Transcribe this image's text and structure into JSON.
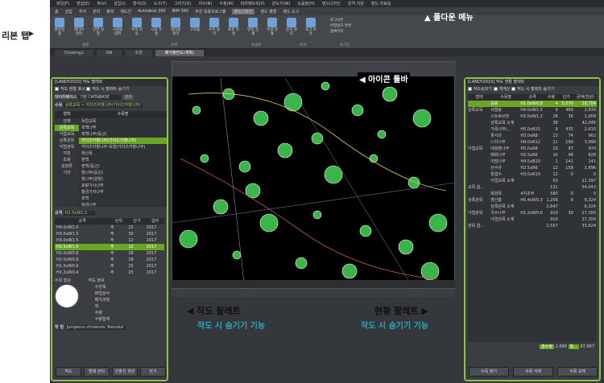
{
  "menu": [
    "파일(F)",
    "편집(E)",
    "뷰(V)",
    "삽입(I)",
    "형식(O)",
    "도구(T)",
    "그리기(D)",
    "치수(N)",
    "수정(M)",
    "파라메트릭(P)",
    "윈도우(W)",
    "도움말(H)",
    "랜드디자인",
    "원격 지원",
    "랜드 자료실"
  ],
  "ribbon_tabs": [
    "홈",
    "삽입",
    "주석",
    "관리",
    "출력",
    "애드인",
    "Autodesk 360",
    "BIM 360",
    "추천 응용프로그램",
    "랜드디자인",
    "랜드 평형",
    "랜드 도구"
  ],
  "ribbon_buttons": [
    "환경설정",
    "레이어 관리",
    "단면 설정",
    "시설물 입력",
    "수목 이동",
    "시점 작성",
    "테이블 정리",
    "구조물",
    "수목 정리",
    "표준 작성",
    "면적 집계",
    "수량 산출",
    "문서 관리",
    "로그 아웃"
  ],
  "ribbon_groups": [
    "설정",
    "수목",
    "수량표",
    "문서",
    "로그인"
  ],
  "login_items": [
    "로그아웃",
    "비밀번호 변경",
    "홈페이지"
  ],
  "doc_tabs": [
    "Drawing1",
    "NN",
    "조경",
    "배식평면도(계획)"
  ],
  "annotations": {
    "ribbon_tab": "리본 탭",
    "pulldown": "풀다운 메뉴",
    "icon_toolbar": "아이콘 툴바",
    "work_palette": "작도 팔레트",
    "status_palette": "현황 팔레트",
    "hide_caption": "작도 시 숨기기 기능"
  },
  "left": {
    "title": "[LANDY2015] 작도 팔레트",
    "opt1": "작도 현황 표시",
    "opt2": "작도 시 팔레트 숨기기",
    "db_label": "데이터베이스",
    "db_value": "기본 DATABASE",
    "db_btn": "관리",
    "tree_label": "수목",
    "tree_value": "상록교목 > 카이즈카향나무(가이즈카향나무)",
    "col1": "형태",
    "col2": "수목명",
    "cats": [
      "전체",
      "상록교목",
      "낙엽교목",
      "상록관목",
      "낙엽관목",
      "지피",
      "초화",
      "포장류",
      "기타"
    ],
    "trees": [
      "독립교목",
      "측백나무",
      "측백나무(둥근)",
      "카이즈카향나무(가이즈카향나무)",
      "카이즈카향나무-모형(가이즈카향나무)",
      "태산목",
      "편백",
      "편백(둥근)",
      "향나무(둥근)",
      "향나무(원형)",
      "호랑가시나무",
      "황금가지나무",
      "회백",
      "화과나무"
    ],
    "spec_label": "규격",
    "spec_value": "H2.5xW1.0",
    "spec_cols": [
      "규격",
      "단위",
      "단가",
      "일자"
    ],
    "specs": [
      "H4.0xW2.0",
      "H3.5xW1.5",
      "H3.0xW1.5",
      "H2.5xW1.0",
      "H2.0xW0.8",
      "H2.0xW0.8",
      "H1.5xW0.6",
      "H1.2xW0.4"
    ],
    "spec_unit": "주",
    "spec_prices": [
      "25",
      "30",
      "12",
      "12",
      "28",
      "28",
      "25",
      "25"
    ],
    "spec_date": "2017",
    "shape_label": "수목 형상",
    "info_label": "작도 정보",
    "info_rows": [
      "수관폭",
      "W입상수",
      "배치과정",
      "척",
      "수량",
      "수량합계"
    ],
    "name_label": "학 명",
    "name_value": "Juniperus chinensis 'Kaizuka'",
    "footer": [
      "작도",
      "범례 관리",
      "인출선 생성",
      "닫기"
    ]
  },
  "right": {
    "title": "[LANDY2015] 작도 현황 팔레트",
    "opt1": "작도순보기",
    "opt2": "재계산",
    "opt3": "작도 시 팔레트 숨기기",
    "cols": [
      "형태",
      "수목명",
      "규격",
      "수량",
      "단가",
      "금액(천원)"
    ],
    "rows": [
      [
        "",
        "공용",
        "H1.0xW0.8",
        "4",
        "5,070",
        "20,704"
      ],
      [
        "상록교목",
        "사철송",
        "H4.0xW1.5",
        "6",
        "489",
        "2,934"
      ],
      [
        "",
        "스트로브잣",
        "H2.0xW1.2",
        "28",
        "36",
        "1,008"
      ],
      [
        "",
        "상록교목 소계",
        "",
        "38",
        "",
        "42,046"
      ],
      [
        "",
        "가죽나무(...",
        "H5.0xB15",
        "9",
        "435",
        "2,610"
      ],
      [
        "",
        "꽃사과",
        "H3.0xR8",
        "13",
        "74",
        "962"
      ],
      [
        "",
        "느티나무",
        "H4.0xR12",
        "21",
        "190",
        "3,990"
      ],
      [
        "낙엽교목",
        "대왕참나무",
        "H5.0xR8",
        "10",
        "97",
        "970"
      ],
      [
        "",
        "매화나무",
        "H2.5xR6",
        "16",
        "48",
        "828"
      ],
      [
        "",
        "이팝나무",
        "H4.5xB10",
        "1",
        "141",
        "141"
      ],
      [
        "",
        "산수유",
        "H2.5xR6",
        "12",
        "158",
        "1,896"
      ],
      [
        "",
        "칠엽수",
        "H3.0xR10",
        "12",
        "0",
        "0"
      ],
      [
        "",
        "낙엽교목 소계",
        "",
        "93",
        "",
        "11,397"
      ],
      [
        "교목 합...",
        "",
        "",
        "131",
        "",
        "54,043"
      ],
      [
        "",
        "회양목",
        "4지조주",
        "580",
        "0",
        "0"
      ],
      [
        "상록관목",
        "영산홍",
        "H0.4xW0.3",
        "1,256",
        "6",
        "6,324"
      ],
      [
        "",
        "상록관목 소계",
        "",
        "1,647",
        "",
        "6,324"
      ],
      [
        "낙엽관목",
        "국수나무",
        "H1.2xW0.6",
        "910",
        "30",
        "27,300"
      ],
      [
        "",
        "낙엽관목 소계",
        "",
        "910",
        "",
        "27,300"
      ],
      [
        "관목 합...",
        "",
        "",
        "2,557",
        "",
        "33,624"
      ]
    ],
    "total_label": "총수량",
    "total_qty": "2,688",
    "total_sum_label": "총...",
    "total_sum": "87,667",
    "footer": [
      "수목 찾기",
      "수목 삭제",
      "수목 교체"
    ]
  },
  "colors": {
    "accent": "#8fc43f",
    "highlight": "#6aa624",
    "teal": "#2aa8b8"
  }
}
